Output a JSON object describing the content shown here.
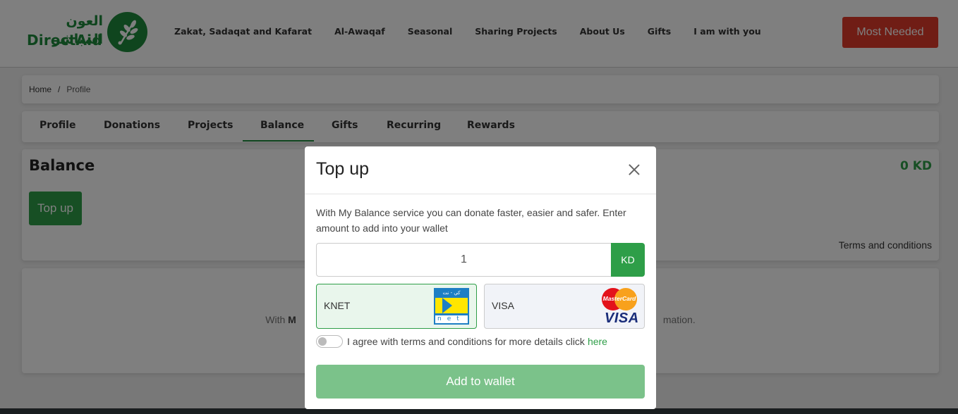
{
  "header": {
    "logo_arabic": "العون المباشر",
    "logo_english": "DirectAid",
    "nav": [
      "Zakat, Sadaqat and Kafarat",
      "Al-Awaqaf",
      "Seasonal",
      "Sharing Projects",
      "About Us",
      "Gifts",
      "I am with you"
    ],
    "cta_label": "Most Needed"
  },
  "breadcrumb": {
    "home": "Home",
    "separator": "/",
    "current": "Profile"
  },
  "tabs": [
    {
      "label": "Profile",
      "active": false
    },
    {
      "label": "Donations",
      "active": false
    },
    {
      "label": "Projects",
      "active": false
    },
    {
      "label": "Balance",
      "active": true
    },
    {
      "label": "Gifts",
      "active": false
    },
    {
      "label": "Recurring",
      "active": false
    },
    {
      "label": "Rewards",
      "active": false
    }
  ],
  "balance": {
    "title": "Balance",
    "amount": "0 KD",
    "topup_label": "Top up",
    "terms_label": "Terms and conditions"
  },
  "history": {
    "text_start": "With ",
    "text_bold": "M",
    "text_end": "mation."
  },
  "modal": {
    "title": "Top up",
    "description": "With My Balance service you can donate faster, easier and safer. Enter amount to add into your wallet",
    "amount_value": "1",
    "currency": "KD",
    "payment_options": [
      {
        "label": "KNET",
        "selected": true,
        "logo": "knet-logo"
      },
      {
        "label": "VISA",
        "selected": false,
        "logo": "mastercard-visa-logo"
      }
    ],
    "knet_logo_top": "كي - نت",
    "knet_logo_bottom": "net",
    "mastercard_text": "MasterCard",
    "visa_text": "VISA",
    "agree_text": "I agree with terms and conditions for more details click",
    "agree_link": "here",
    "agree_checked": false,
    "submit_label": "Add to wallet"
  },
  "colors": {
    "brand_green": "#2e9e48",
    "cta_red": "#e13b2a"
  }
}
